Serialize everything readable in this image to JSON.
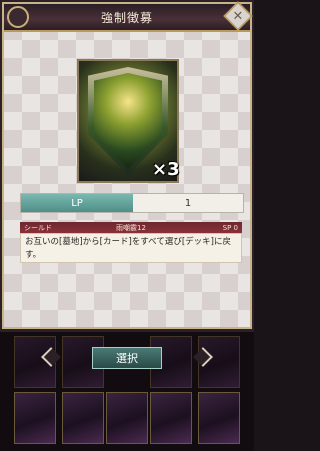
{
  "dialog": {
    "title": "強制徴募",
    "close_symbol": "✕"
  },
  "card": {
    "multiplier": "×3"
  },
  "lp": {
    "label": "LP",
    "value": "1"
  },
  "card_info": {
    "type": "シールド",
    "code": "雨嘲霰12",
    "sp": "SP  0",
    "text": "お互いの[墓地]から[カード]をすべて選び[デッキ]に戻す。"
  },
  "controls": {
    "select_label": "選択"
  },
  "icons": {
    "close": "close-icon",
    "left_arrow": "chevron-left-icon",
    "right_arrow": "chevron-right-icon"
  },
  "colors": {
    "title_bar": "#3a2830",
    "accent_gold": "#b89a5c",
    "lp_teal": "#5f9f98",
    "info_header": "#7a2c34"
  }
}
